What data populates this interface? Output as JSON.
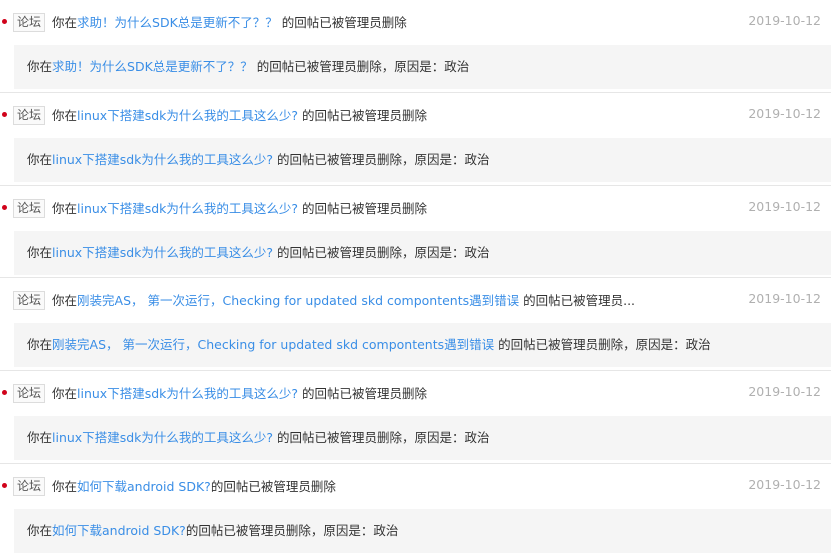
{
  "accent_link_color": "#3a8ee6",
  "unread_dot_color": "#d0021b",
  "notifications": [
    {
      "unread": true,
      "tag": "论坛",
      "prefix": "你在",
      "post_title": "求助！为什么SDK总是更新不了？？",
      "suffix": " 的回帖已被管理员删除",
      "date": "2019-10-12",
      "detail_prefix": "你在",
      "detail_title": "求助！为什么SDK总是更新不了？？",
      "detail_suffix": " 的回帖已被管理员删除，原因是：政治"
    },
    {
      "unread": true,
      "tag": "论坛",
      "prefix": "你在",
      "post_title": "linux下搭建sdk为什么我的工具这么少?",
      "suffix": " 的回帖已被管理员删除",
      "date": "2019-10-12",
      "detail_prefix": "你在",
      "detail_title": "linux下搭建sdk为什么我的工具这么少?",
      "detail_suffix": " 的回帖已被管理员删除，原因是：政治"
    },
    {
      "unread": true,
      "tag": "论坛",
      "prefix": "你在",
      "post_title": "linux下搭建sdk为什么我的工具这么少?",
      "suffix": " 的回帖已被管理员删除",
      "date": "2019-10-12",
      "detail_prefix": "你在",
      "detail_title": "linux下搭建sdk为什么我的工具这么少?",
      "detail_suffix": " 的回帖已被管理员删除，原因是：政治"
    },
    {
      "unread": false,
      "tag": "论坛",
      "prefix": "你在",
      "post_title": "刚装完AS， 第一次运行，Checking for updated skd compontents遇到错误",
      "suffix": " 的回帖已被管理员...",
      "date": "2019-10-12",
      "detail_prefix": "你在",
      "detail_title": "刚装完AS， 第一次运行，Checking for updated skd compontents遇到错误",
      "detail_suffix": " 的回帖已被管理员删除，原因是：政治"
    },
    {
      "unread": true,
      "tag": "论坛",
      "prefix": "你在",
      "post_title": "linux下搭建sdk为什么我的工具这么少?",
      "suffix": " 的回帖已被管理员删除",
      "date": "2019-10-12",
      "detail_prefix": "你在",
      "detail_title": "linux下搭建sdk为什么我的工具这么少?",
      "detail_suffix": " 的回帖已被管理员删除，原因是：政治"
    },
    {
      "unread": true,
      "tag": "论坛",
      "prefix": "你在",
      "post_title": "如何下载android SDK?",
      "suffix": "的回帖已被管理员删除",
      "date": "2019-10-12",
      "detail_prefix": "你在",
      "detail_title": "如何下载android SDK?",
      "detail_suffix": "的回帖已被管理员删除，原因是：政治"
    }
  ]
}
